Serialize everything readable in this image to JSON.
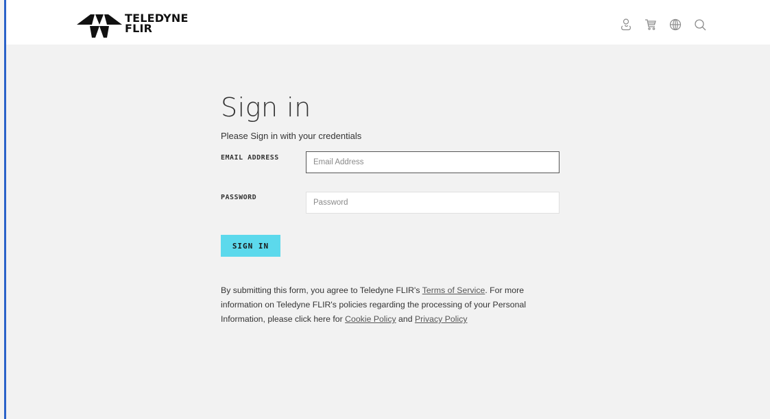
{
  "brand": {
    "logo_line1": "TELEDYNE",
    "logo_line2": "FLIR"
  },
  "header": {
    "icons": [
      "account-icon",
      "cart-icon",
      "globe-icon",
      "search-icon"
    ]
  },
  "signin": {
    "title": "Sign in",
    "subtitle": "Please Sign in with your credentials",
    "email_label": "EMAIL ADDRESS",
    "email_placeholder": "Email Address",
    "email_value": "",
    "password_label": "PASSWORD",
    "password_placeholder": "Password",
    "password_value": "",
    "button_label": "SIGN IN"
  },
  "legal": {
    "text1": "By submitting this form, you agree to Teledyne FLIR's ",
    "terms_link": "Terms of Service",
    "text2": ". For more information on Teledyne FLIR's policies regarding the processing of your Personal Information, please click here for ",
    "cookie_link": "Cookie Policy",
    "text3": " and ",
    "privacy_link": "Privacy Policy"
  },
  "colors": {
    "accent_button": "#5cd9ec",
    "page_background": "#f2f2f2",
    "header_background": "#ffffff",
    "left_edge": "#2a62c9"
  }
}
